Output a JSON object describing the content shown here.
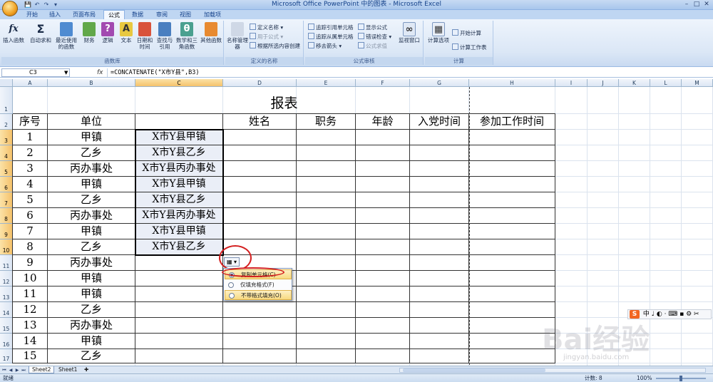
{
  "window": {
    "title": "Microsoft Office PowerPoint 中的图表 - Microsoft Excel",
    "minimize": "–",
    "maximize": "□",
    "close": "✕"
  },
  "qat": [
    "💾",
    "↶",
    "↷",
    "▾"
  ],
  "tabs": [
    "开始",
    "插入",
    "页面布局",
    "公式",
    "数据",
    "审阅",
    "视图",
    "加载项"
  ],
  "active_tab": "公式",
  "ribbon": {
    "groups": {
      "library": "函数库",
      "names": "定义的名称",
      "audit": "公式审核",
      "calc": "计算"
    },
    "buttons": {
      "insert_function": "插入函数",
      "autosum": "自动求和",
      "recent": "最近使用的函数",
      "financial": "财务",
      "logical": "逻辑",
      "text": "文本",
      "datetime": "日期和时间",
      "lookup": "查找与引用",
      "math": "数学和三角函数",
      "other": "其他函数",
      "name_manager": "名称管理器",
      "define_name": "定义名称",
      "use_in_formula": "用于公式",
      "create_from_selection": "根据所选内容创建",
      "trace_precedents": "追踪引用单元格",
      "trace_dependents": "追踪从属单元格",
      "remove_arrows": "移去箭头",
      "show_formulas": "显示公式",
      "error_checking": "错误检查",
      "evaluate_formula": "公式求值",
      "watch_window": "监视窗口",
      "calc_options": "计算选项",
      "calc_now": "开始计算",
      "calc_sheet": "计算工作表"
    }
  },
  "formula_bar": {
    "name_box": "C3",
    "fx": "fx",
    "formula": "=CONCATENATE(\"X市Y县\",B3)"
  },
  "columns": [
    "A",
    "B",
    "C",
    "D",
    "E",
    "F",
    "G",
    "H",
    "I",
    "J",
    "K",
    "L",
    "M"
  ],
  "rows": [
    "1",
    "2",
    "3",
    "4",
    "5",
    "6",
    "7",
    "8",
    "9",
    "10",
    "11",
    "12",
    "13",
    "14",
    "15",
    "16",
    "17"
  ],
  "table": {
    "title": "报表",
    "headers": {
      "seq": "序号",
      "unit": "单位",
      "c": "",
      "name": "姓名",
      "post": "职务",
      "age": "年龄",
      "party": "入党时间",
      "work": "参加工作时间"
    },
    "rows": [
      {
        "seq": "1",
        "unit": "甲镇",
        "c": "X市Y县甲镇"
      },
      {
        "seq": "2",
        "unit": "乙乡",
        "c": "X市Y县乙乡"
      },
      {
        "seq": "3",
        "unit": "丙办事处",
        "c": "X市Y县丙办事处"
      },
      {
        "seq": "4",
        "unit": "甲镇",
        "c": "X市Y县甲镇"
      },
      {
        "seq": "5",
        "unit": "乙乡",
        "c": "X市Y县乙乡"
      },
      {
        "seq": "6",
        "unit": "丙办事处",
        "c": "X市Y县丙办事处"
      },
      {
        "seq": "7",
        "unit": "甲镇",
        "c": "X市Y县甲镇"
      },
      {
        "seq": "8",
        "unit": "乙乡",
        "c": "X市Y县乙乡"
      },
      {
        "seq": "9",
        "unit": "丙办事处",
        "c": ""
      },
      {
        "seq": "10",
        "unit": "甲镇",
        "c": ""
      },
      {
        "seq": "11",
        "unit": "甲镇",
        "c": ""
      },
      {
        "seq": "12",
        "unit": "乙乡",
        "c": ""
      },
      {
        "seq": "13",
        "unit": "丙办事处",
        "c": ""
      },
      {
        "seq": "14",
        "unit": "甲镇",
        "c": ""
      },
      {
        "seq": "15",
        "unit": "乙乡",
        "c": ""
      }
    ]
  },
  "autofill_menu": {
    "icon": "▦ ▾",
    "items": [
      "复制单元格(C)",
      "仅填充格式(F)",
      "不带格式填充(O)"
    ]
  },
  "sheet_tabs": [
    "Sheet2",
    "Sheet1"
  ],
  "sheet_nav": [
    "⏮",
    "◀",
    "▶",
    "⏭"
  ],
  "status": {
    "ready": "就绪",
    "count": "计数: 8",
    "zoom": "100%"
  },
  "ime": {
    "logo": "S",
    "mode": "中",
    "icons": "♩ ◐ ⋅ ⌨ ▪ ⚙ ✂"
  },
  "watermark": {
    "logo": "Bai经验",
    "url": "jingyan.baidu.com"
  }
}
